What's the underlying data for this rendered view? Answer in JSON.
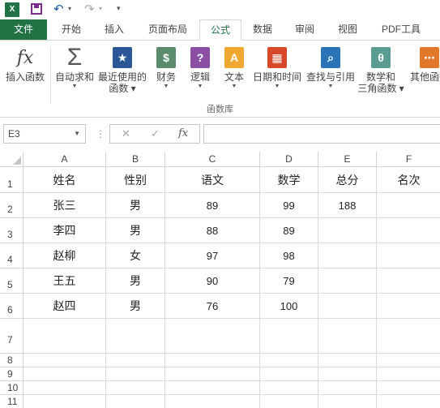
{
  "qat": {
    "app_icon": "X",
    "save_icon": "save-icon",
    "undo_icon": "undo-icon",
    "redo_icon": "redo-icon"
  },
  "tabs": [
    {
      "label": "文件"
    },
    {
      "label": "开始"
    },
    {
      "label": "插入"
    },
    {
      "label": "页面布局"
    },
    {
      "label": "公式"
    },
    {
      "label": "数据"
    },
    {
      "label": "审阅"
    },
    {
      "label": "视图"
    },
    {
      "label": "PDF工具"
    }
  ],
  "ribbon": {
    "insert_function": "插入函数",
    "autosum": "自动求和",
    "recent": [
      "最近使用的",
      "函数"
    ],
    "financial": "财务",
    "logical": "逻辑",
    "text": "文本",
    "datetime": "日期和时间",
    "lookup": "查找与引用",
    "math": [
      "数学和",
      "三角函数"
    ],
    "more": "其他函数",
    "group_label": "函数库"
  },
  "formula_bar": {
    "name_box": "E3",
    "cancel": "✕",
    "enter": "✓",
    "fx": "fx",
    "value": ""
  },
  "columns": [
    "A",
    "B",
    "C",
    "D",
    "E",
    "F"
  ],
  "rows": [
    {
      "num": "1",
      "cells": [
        "姓名",
        "性别",
        "语文",
        "数学",
        "总分",
        "名次"
      ]
    },
    {
      "num": "2",
      "cells": [
        "张三",
        "男",
        "89",
        "99",
        "188",
        ""
      ]
    },
    {
      "num": "3",
      "cells": [
        "李四",
        "男",
        "88",
        "89",
        "",
        ""
      ]
    },
    {
      "num": "4",
      "cells": [
        "赵柳",
        "女",
        "97",
        "98",
        "",
        ""
      ]
    },
    {
      "num": "5",
      "cells": [
        "王五",
        "男",
        "90",
        "79",
        "",
        ""
      ]
    },
    {
      "num": "6",
      "cells": [
        "赵四",
        "男",
        "76",
        "100",
        "",
        ""
      ]
    },
    {
      "num": "7",
      "cells": [
        "",
        "",
        "",
        "",
        "",
        ""
      ]
    },
    {
      "num": "8",
      "cells": [
        "",
        "",
        "",
        "",
        "",
        ""
      ]
    },
    {
      "num": "9",
      "cells": [
        "",
        "",
        "",
        "",
        "",
        ""
      ]
    },
    {
      "num": "10",
      "cells": [
        "",
        "",
        "",
        "",
        "",
        ""
      ]
    },
    {
      "num": "11",
      "cells": [
        "",
        "",
        "",
        "",
        "",
        ""
      ]
    }
  ],
  "colors": {
    "accent": "#217346"
  }
}
